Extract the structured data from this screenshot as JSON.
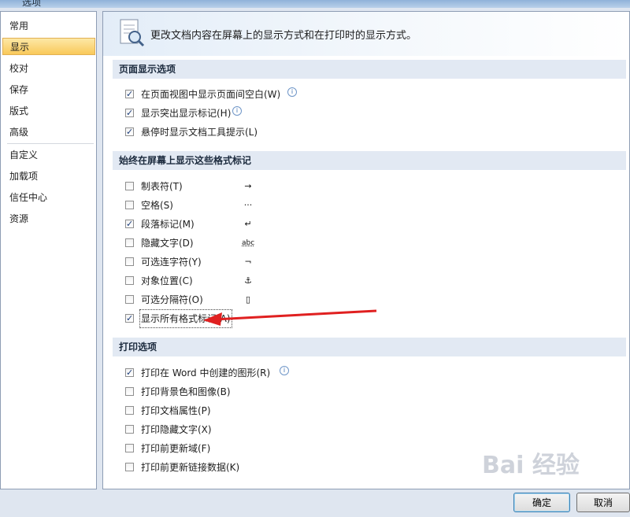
{
  "window": {
    "title": "选项"
  },
  "sidebar": {
    "items": [
      {
        "label": "常用"
      },
      {
        "label": "显示",
        "selected": true
      },
      {
        "label": "校对"
      },
      {
        "label": "保存"
      },
      {
        "label": "版式"
      },
      {
        "label": "高级"
      },
      {
        "label": "自定义"
      },
      {
        "label": "加载项"
      },
      {
        "label": "信任中心"
      },
      {
        "label": "资源"
      }
    ]
  },
  "banner": {
    "text": "更改文档内容在屏幕上的显示方式和在打印时的显示方式。",
    "icon": "document-magnifier-icon"
  },
  "page_display": {
    "title": "页面显示选项",
    "options": [
      {
        "label": "在页面视图中显示页面间空白(W)",
        "checked": true,
        "info": true
      },
      {
        "label": "显示突出显示标记(H)",
        "checked": true,
        "info": true
      },
      {
        "label": "悬停时显示文档工具提示(L)",
        "checked": true,
        "info": false
      }
    ]
  },
  "format_marks": {
    "title": "始终在屏幕上显示这些格式标记",
    "options": [
      {
        "label": "制表符(T)",
        "checked": false,
        "glyph": "→"
      },
      {
        "label": "空格(S)",
        "checked": false,
        "glyph": "···"
      },
      {
        "label": "段落标记(M)",
        "checked": true,
        "glyph": "↵"
      },
      {
        "label": "隐藏文字(D)",
        "checked": false,
        "glyph": "abc"
      },
      {
        "label": "可选连字符(Y)",
        "checked": false,
        "glyph": "¬"
      },
      {
        "label": "对象位置(C)",
        "checked": false,
        "glyph": "⚓"
      },
      {
        "label": "可选分隔符(O)",
        "checked": false,
        "glyph": "▯"
      },
      {
        "label": "显示所有格式标记(A)",
        "checked": true,
        "glyph": ""
      }
    ]
  },
  "print_options": {
    "title": "打印选项",
    "options": [
      {
        "label": "打印在 Word 中创建的图形(R)",
        "checked": true,
        "info": true
      },
      {
        "label": "打印背景色和图像(B)",
        "checked": false,
        "info": false
      },
      {
        "label": "打印文档属性(P)",
        "checked": false,
        "info": false
      },
      {
        "label": "打印隐藏文字(X)",
        "checked": false,
        "info": false
      },
      {
        "label": "打印前更新域(F)",
        "checked": false,
        "info": false
      },
      {
        "label": "打印前更新链接数据(K)",
        "checked": false,
        "info": false
      }
    ]
  },
  "buttons": {
    "ok": "确定",
    "cancel": "取消"
  },
  "watermark": {
    "text": "Bai 经验"
  },
  "info_glyph": "i",
  "colors": {
    "arrow": "#e02020",
    "selected": "#f9c95a",
    "section": "#e2e9f3"
  }
}
